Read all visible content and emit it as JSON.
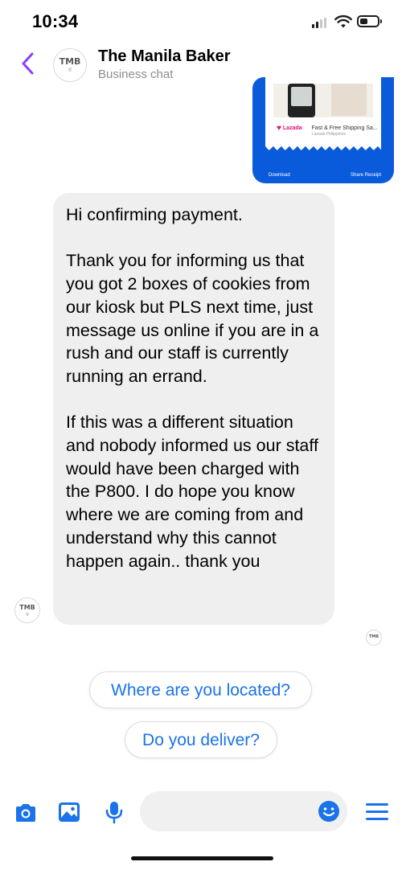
{
  "status_bar": {
    "time": "10:34",
    "icons": [
      "signal-icon",
      "wifi-icon",
      "battery-icon"
    ]
  },
  "header": {
    "back_icon": "chevron-left-icon",
    "avatar_monogram": "TMB",
    "title": "The Manila Baker",
    "subtitle": "Business chat"
  },
  "attachment": {
    "ad_brand": "Lazada",
    "ad_text": "Fast & Free Shipping Sa...",
    "ad_note": "Lazada Philippines",
    "download_label": "Download",
    "share_label": "Share Receipt"
  },
  "message": {
    "avatar_monogram": "TMB",
    "text": "Hi confirming payment.\n\nThank you for informing us that you got 2 boxes of cookies from our kiosk but PLS next time, just message us online if you are in a rush and our staff is currently running an errand.\n\nIf this was a different situation and nobody informed us our staff would have been charged with the P800. I do hope you know where we are coming from and understand why this cannot happen again.. thank you"
  },
  "read_receipt": {
    "avatar_monogram": "TMB"
  },
  "quick_replies": [
    "Where are you located?",
    "Do you deliver?"
  ],
  "composer": {
    "input_value": "",
    "icons": [
      "camera-icon",
      "image-icon",
      "microphone-icon",
      "emoji-icon",
      "menu-icon"
    ]
  },
  "colors": {
    "accent": "#1a73e8",
    "back_chevron": "#8a3ffc",
    "bubble_bg": "#efeff0",
    "receipt_blue": "#0a5bdc"
  }
}
